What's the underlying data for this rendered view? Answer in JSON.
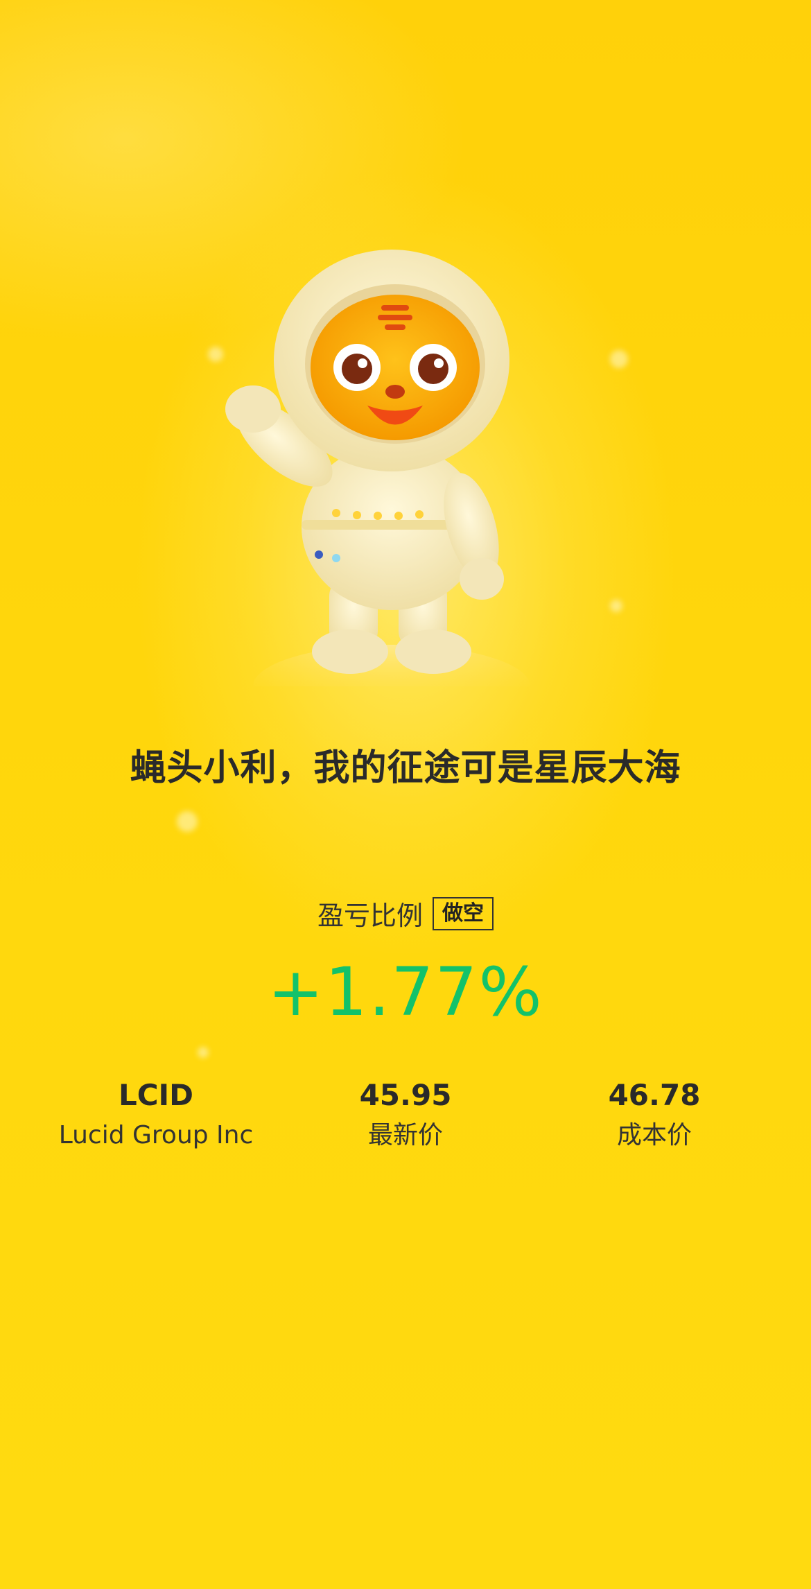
{
  "slogan": "蝇头小利，我的征途可是星辰大海",
  "profit_ratio": {
    "label": "盈亏比例",
    "badge": "做空",
    "value": "+1.77%"
  },
  "stock": {
    "ticker": "LCID",
    "name": "Lucid Group Inc"
  },
  "prices": {
    "latest_value": "45.95",
    "latest_label": "最新价",
    "cost_value": "46.78",
    "cost_label": "成本价"
  },
  "colors": {
    "background": "#FFD60A",
    "positive": "#13C26A",
    "text": "#2A2A2A"
  }
}
